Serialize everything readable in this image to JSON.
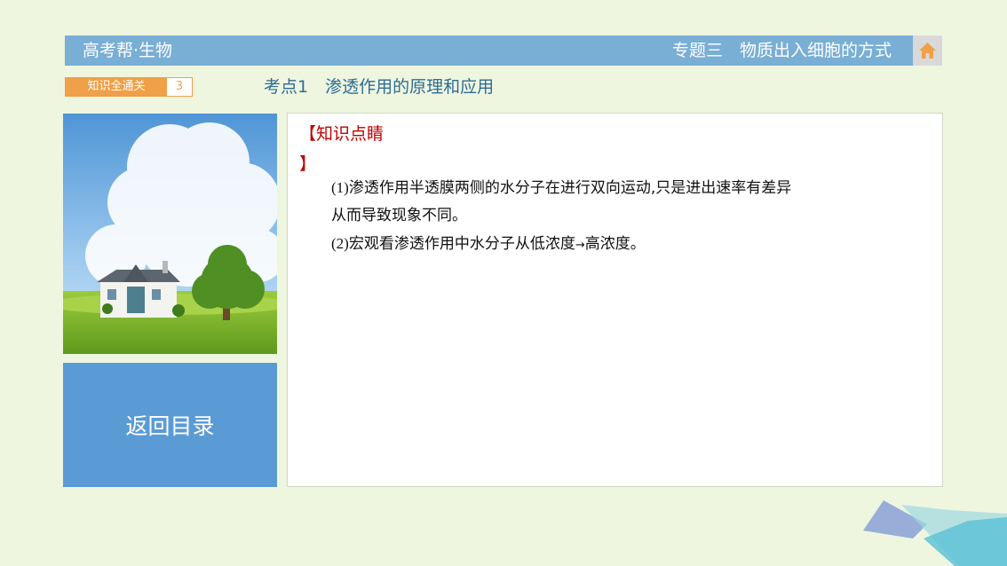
{
  "header": {
    "left_title": "高考帮·生物",
    "right_title": "专题三　物质出入细胞的方式",
    "home_icon": "home-icon"
  },
  "badge": {
    "label": "知识全通关",
    "number": "3"
  },
  "topic": "考点1　渗透作用的原理和应用",
  "sidebar": {
    "back_label": "返回目录"
  },
  "content": {
    "section_open": "【知识点睛",
    "section_close": "】",
    "items": [
      {
        "num": "(1)",
        "text": "渗透作用半透膜两侧的水分子在进行双向运动,只是进出速率有差异"
      },
      {
        "num": "",
        "text": "从而导致现象不同。"
      },
      {
        "num": "(2)",
        "text": "宏观看渗透作用中水分子从低浓度",
        "arrow": "→",
        "text2": "高浓度。"
      }
    ]
  },
  "colors": {
    "header_bg": "#79aed5",
    "badge_bg": "#f0a048",
    "back_button_bg": "#5b9bd5",
    "section_title": "#c00000",
    "topic_text": "#2f6c93",
    "home_icon": "#f0a048"
  }
}
